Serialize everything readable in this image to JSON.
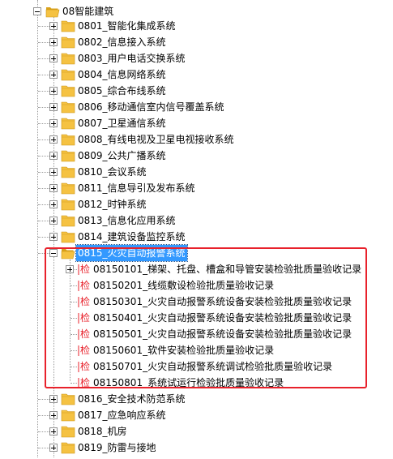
{
  "tree": {
    "root": {
      "label": "08智能建筑",
      "expanded": true,
      "icon": "open-folder-icon"
    },
    "systems_before": [
      {
        "id": "0801",
        "label": "0801_智能化集成系统"
      },
      {
        "id": "0802",
        "label": "0802_信息接入系统"
      },
      {
        "id": "0803",
        "label": "0803_用户电话交换系统"
      },
      {
        "id": "0804",
        "label": "0804_信息网络系统"
      },
      {
        "id": "0805",
        "label": "0805_综合布线系统"
      },
      {
        "id": "0806",
        "label": "0806_移动通信室内信号覆盖系统"
      },
      {
        "id": "0807",
        "label": "0807_卫星通信系统"
      },
      {
        "id": "0808",
        "label": "0808_有线电视及卫星电视接收系统"
      },
      {
        "id": "0809",
        "label": "0809_公共广播系统"
      },
      {
        "id": "0810",
        "label": "0810_会议系统"
      },
      {
        "id": "0811",
        "label": "0811_信息导引及发布系统"
      },
      {
        "id": "0812",
        "label": "0812_时钟系统"
      },
      {
        "id": "0813",
        "label": "0813_信息化应用系统"
      },
      {
        "id": "0814",
        "label": "0814_建筑设备监控系统"
      }
    ],
    "selected_system": {
      "id": "0815",
      "label": "0815_火灾自动报警系统",
      "expanded": true,
      "selected": true,
      "children": [
        {
          "label": "08150101_梯架、托盘、槽盒和导管安装检验批质量验收记录",
          "icon_glyph": "检",
          "has_expander": true
        },
        {
          "label": "08150201_线缆敷设检验批质量验收记录",
          "icon_glyph": "检",
          "has_expander": false
        },
        {
          "label": "08150301_火灾自动报警系统设备安装检验批质量验收记录",
          "icon_glyph": "检",
          "has_expander": false
        },
        {
          "label": "08150401_火灾自动报警系统设备安装检验批质量验收记录",
          "icon_glyph": "检",
          "has_expander": false
        },
        {
          "label": "08150501_火灾自动报警系统设备安装检验批质量验收记录",
          "icon_glyph": "检",
          "has_expander": false
        },
        {
          "label": "08150601_软件安装检验批质量验收记录",
          "icon_glyph": "检",
          "has_expander": false
        },
        {
          "label": "08150701_火灾自动报警系统调试检验批质量验收记录",
          "icon_glyph": "检",
          "has_expander": false
        },
        {
          "label": "08150801_系统试运行检验批质量验收记录",
          "icon_glyph": "检",
          "has_expander": false
        }
      ]
    },
    "systems_after": [
      {
        "id": "0816",
        "label": "0816_安全技术防范系统"
      },
      {
        "id": "0817",
        "label": "0817_应急响应系统"
      },
      {
        "id": "0818",
        "label": "0818_机房"
      },
      {
        "id": "0819",
        "label": "0819_防雷与接地"
      }
    ]
  },
  "colors": {
    "folder": "#f5c242",
    "folder_dark": "#d9a21b",
    "selection": "#3399ff",
    "highlight_border": "#e8212b",
    "check_icon": "#e8212b"
  }
}
